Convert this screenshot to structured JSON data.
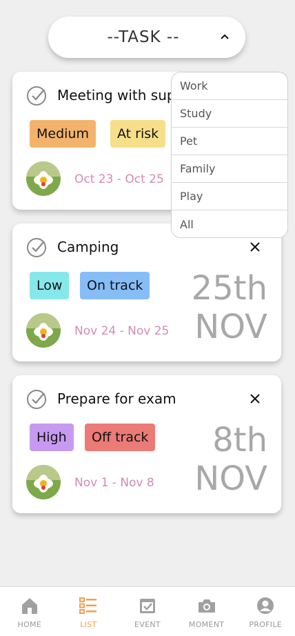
{
  "selector": {
    "label": "--TASK --"
  },
  "colors": {
    "medium": "#f3b36b",
    "at_risk": "#f7df8a",
    "low": "#86e8ea",
    "on_track": "#86bdf7",
    "high": "#c69af0",
    "off_track": "#ec7a77",
    "date_pink": "#d58ab7",
    "nav_active": "#f0a050"
  },
  "tasks": [
    {
      "title": "Meeting with sup",
      "tags": [
        "Medium",
        "At risk"
      ],
      "dates": "Oct 23 - Oct 25"
    },
    {
      "title": "Camping",
      "tags": [
        "Low",
        "On track"
      ],
      "dates": "Nov 24 - Nov 25",
      "big_day": "25th",
      "big_month": "NOV"
    },
    {
      "title": "Prepare for exam",
      "tags": [
        "High",
        "Off track"
      ],
      "dates": "Nov 1 - Nov 8",
      "big_day": "8th",
      "big_month": "NOV"
    }
  ],
  "dropdown": [
    "Work",
    "Study",
    "Pet",
    "Family",
    "Play",
    "All"
  ],
  "nav": [
    {
      "label": "HOME",
      "icon": "home-icon"
    },
    {
      "label": "LIST",
      "icon": "list-icon",
      "active": true
    },
    {
      "label": "EVENT",
      "icon": "calendar-icon"
    },
    {
      "label": "MOMENT",
      "icon": "camera-icon"
    },
    {
      "label": "PROFILE",
      "icon": "profile-icon"
    }
  ]
}
